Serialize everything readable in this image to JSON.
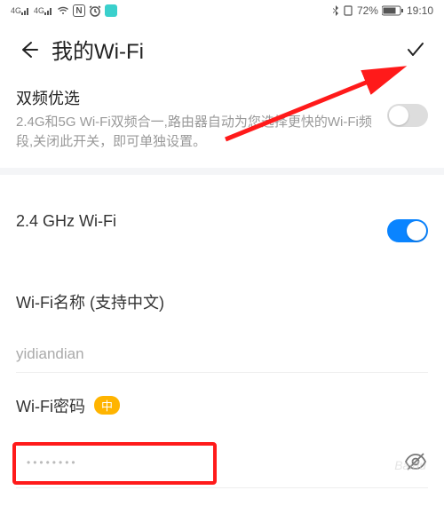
{
  "status": {
    "signal1": "4G",
    "signal2": "4G",
    "nfc": "N",
    "battery": "72%",
    "time": "19:10"
  },
  "header": {
    "title": "我的Wi-Fi"
  },
  "dualBand": {
    "title": "双频优选",
    "desc": "2.4G和5G Wi-Fi双频合一,路由器自动为您选择更快的Wi-Fi频段,关闭此开关，即可单独设置。",
    "enabled": false
  },
  "ghz": {
    "label": "2.4 GHz Wi-Fi",
    "enabled": true
  },
  "nameField": {
    "label": "Wi-Fi名称 (支持中文)",
    "value": "yidiandian"
  },
  "passwordField": {
    "label": "Wi-Fi密码",
    "strength": "中",
    "masked": "••••••••"
  },
  "watermark": "Baidu"
}
